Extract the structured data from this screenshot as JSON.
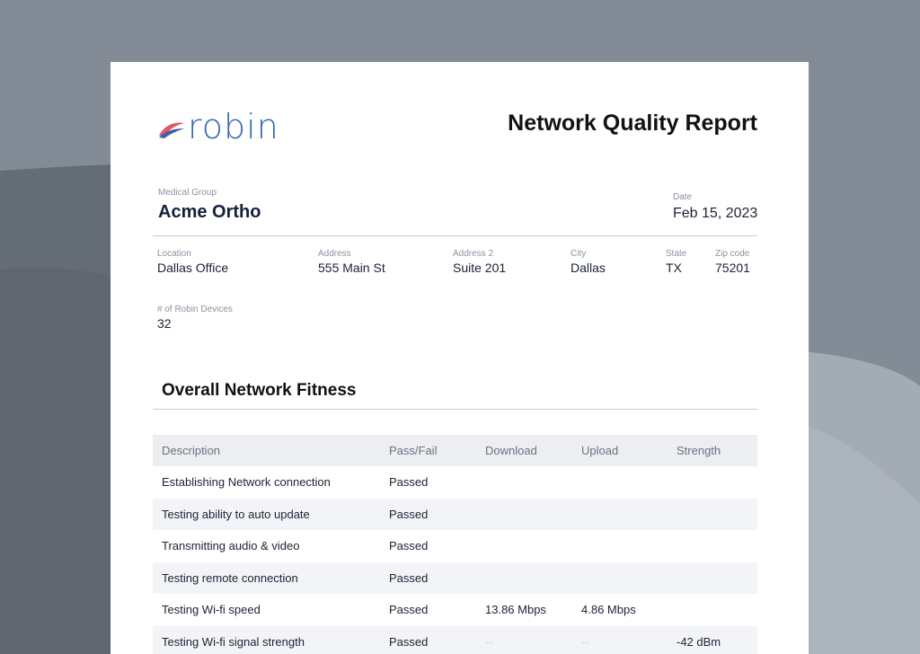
{
  "brand": {
    "name": "robin",
    "accent": "#3767b1",
    "logo_icon": "robin-swoosh-icon"
  },
  "report": {
    "title": "Network Quality Report"
  },
  "group": {
    "label": "Medical Group",
    "value": "Acme Ortho"
  },
  "date": {
    "label": "Date",
    "value": "Feb 15, 2023"
  },
  "location": {
    "fields": [
      {
        "label": "Location",
        "value": "Dallas Office"
      },
      {
        "label": "Address",
        "value": "555 Main St"
      },
      {
        "label": "Address 2",
        "value": "Suite 201"
      },
      {
        "label": "City",
        "value": "Dallas"
      },
      {
        "label": "State",
        "value": "TX"
      },
      {
        "label": "Zip code",
        "value": "75201"
      }
    ]
  },
  "devices": {
    "label": "# of Robin Devices",
    "value": "32"
  },
  "fitness": {
    "title": "Overall Network Fitness",
    "headers": [
      "Description",
      "Pass/Fail",
      "Download",
      "Upload",
      "Strength"
    ],
    "rows": [
      [
        "Establishing Network connection",
        "Passed",
        "",
        "",
        ""
      ],
      [
        "Testing ability to auto update",
        "Passed",
        "",
        "",
        ""
      ],
      [
        "Transmitting audio & video",
        "Passed",
        "",
        "",
        ""
      ],
      [
        "Testing remote connection",
        "Passed",
        "",
        "",
        ""
      ],
      [
        "Testing Wi-fi speed",
        "Passed",
        "13.86 Mbps",
        "4.86 Mbps",
        ""
      ],
      [
        "Testing Wi-fi signal strength",
        "Passed",
        "--",
        "--",
        "-42 dBm"
      ]
    ]
  }
}
